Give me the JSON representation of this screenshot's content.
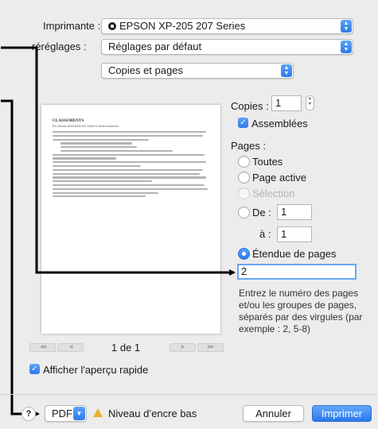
{
  "header": {
    "printer_label": "Imprimante :",
    "printer_value": "EPSON XP-205 207 Series",
    "presets_label": "réréglages :",
    "presets_value": "Réglages par défaut",
    "section_value": "Copies et pages"
  },
  "preview": {
    "doc_title": "CLASSEMENTS",
    "doc_subtitle": "Des rheteurs de Fisheble-Ono Cheiti et chents-transitoires",
    "page_indicator": "1 de 1",
    "first_label": "◀◀",
    "prev_label": "◀",
    "next_label": "▶",
    "last_label": "▶▶"
  },
  "quick_preview": {
    "label": "Afficher l'aperçu rapide",
    "checked": true
  },
  "copies": {
    "label": "Copies :",
    "value": "1",
    "collated_label": "Assemblées",
    "collated_checked": true
  },
  "pages": {
    "label": "Pages :",
    "options": [
      {
        "label": "Toutes",
        "selected": false,
        "enabled": true
      },
      {
        "label": "Page active",
        "selected": false,
        "enabled": true
      },
      {
        "label": "Sélection",
        "selected": false,
        "enabled": false
      }
    ],
    "from_label": "De :",
    "from_value": "1",
    "to_label": "à :",
    "to_value": "1",
    "range_label": "Étendue de pages",
    "range_selected": true,
    "range_value": "2",
    "help_text": "Entrez le numéro des pages et/ou les groupes de pages, séparés par des virgules (par exemple : 2, 5-8)"
  },
  "footer": {
    "help_label": "?",
    "pdf_label": "PDF",
    "ink_label": "Niveau d’encre bas",
    "cancel_label": "Annuler",
    "print_label": "Imprimer"
  },
  "colors": {
    "accent": "#2f79ea",
    "background": "#ececec",
    "warning": "#e6b12a"
  }
}
